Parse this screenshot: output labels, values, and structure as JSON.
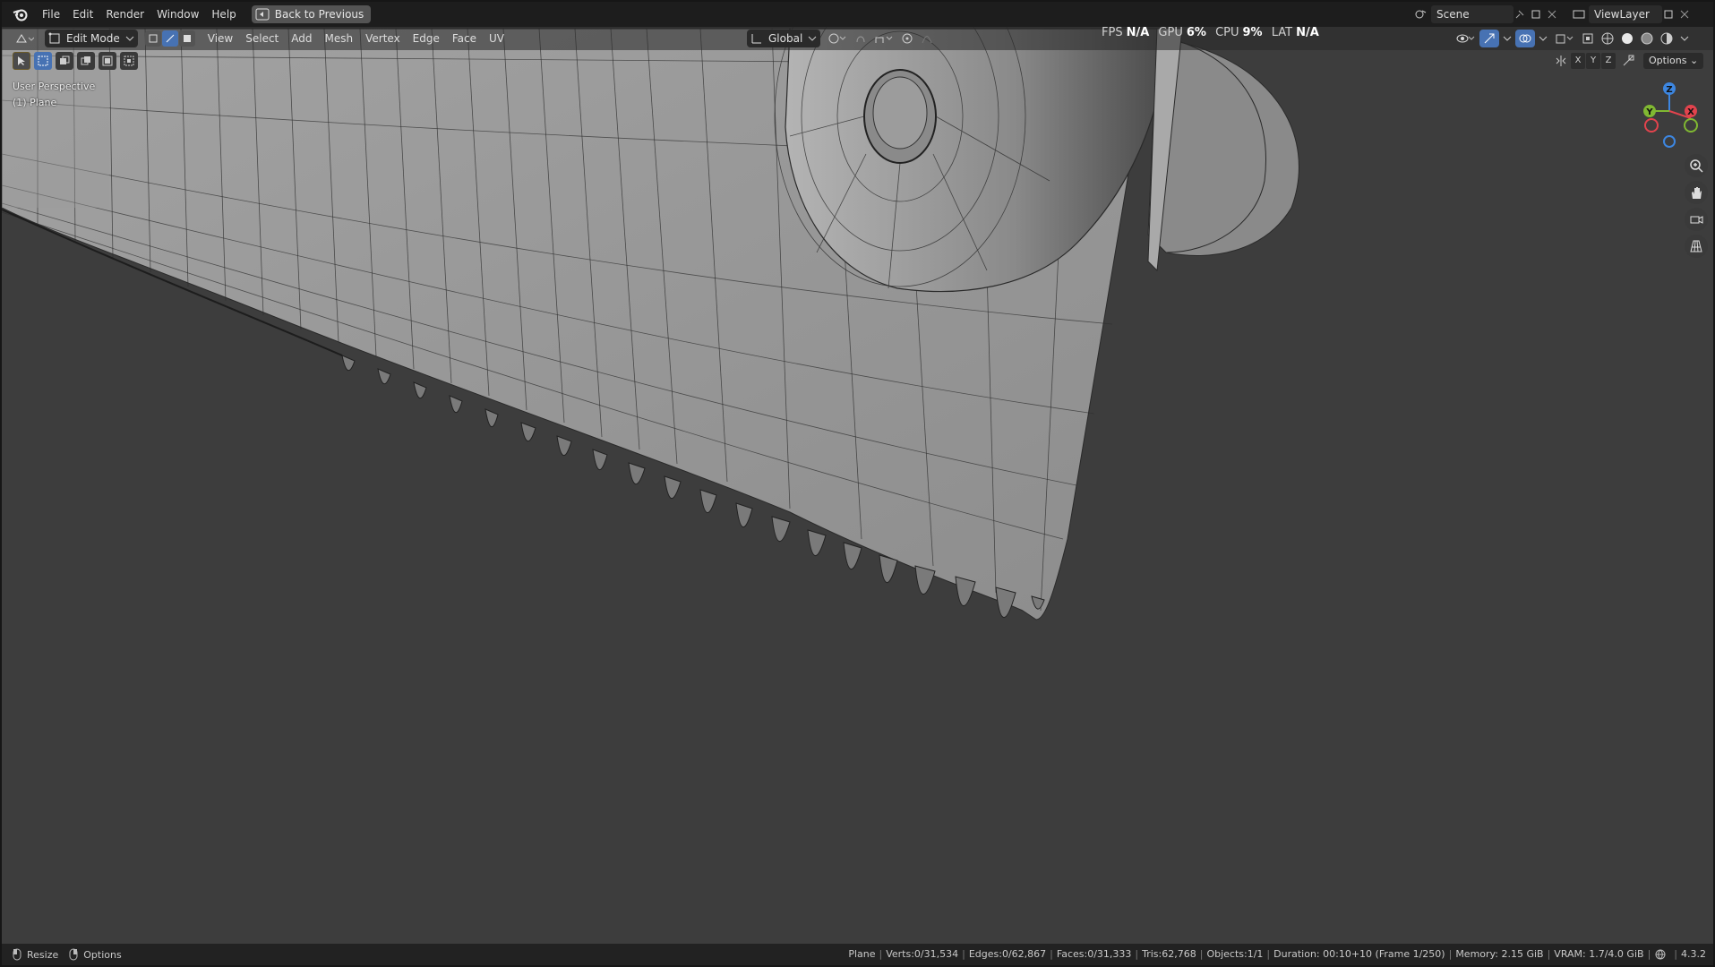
{
  "menubar": {
    "items": [
      "File",
      "Edit",
      "Render",
      "Window",
      "Help"
    ],
    "back_button": "Back to Previous",
    "scene": "Scene",
    "view_layer": "ViewLayer"
  },
  "header": {
    "mode": "Edit Mode",
    "menus": [
      "View",
      "Select",
      "Add",
      "Mesh",
      "Vertex",
      "Edge",
      "Face",
      "UV"
    ],
    "transform_orientation": "Global",
    "options": "Options",
    "axes": [
      "X",
      "Y",
      "Z"
    ]
  },
  "stats": {
    "fps_label": "FPS",
    "fps": "N/A",
    "gpu_label": "GPU",
    "gpu": "6%",
    "cpu_label": "CPU",
    "cpu": "9%",
    "lat_label": "LAT",
    "lat": "N/A"
  },
  "viewport": {
    "perspective": "User Perspective",
    "object": "(1) Plane",
    "gizmo": {
      "z": "Z",
      "y": "Y",
      "x": "X"
    }
  },
  "statusbar": {
    "left": [
      {
        "label": "Resize"
      },
      {
        "label": "Options"
      }
    ],
    "object": "Plane",
    "verts": "Verts:0/31,534",
    "edges": "Edges:0/62,867",
    "faces": "Faces:0/31,333",
    "tris": "Tris:62,768",
    "objects": "Objects:1/1",
    "duration": "Duration: 00:10+10 (Frame 1/250)",
    "memory": "Memory: 2.15 GiB",
    "vram": "VRAM: 1.7/4.0 GiB",
    "version": "4.3.2"
  },
  "colors": {
    "viewport_bg": "#3d3d3d",
    "mesh_fill": "#959595",
    "wire": "#1e1e1e",
    "accent": "#4772b3",
    "gizmo_x": "#e2434d",
    "gizmo_y": "#80b832",
    "gizmo_z": "#3d86e0"
  }
}
